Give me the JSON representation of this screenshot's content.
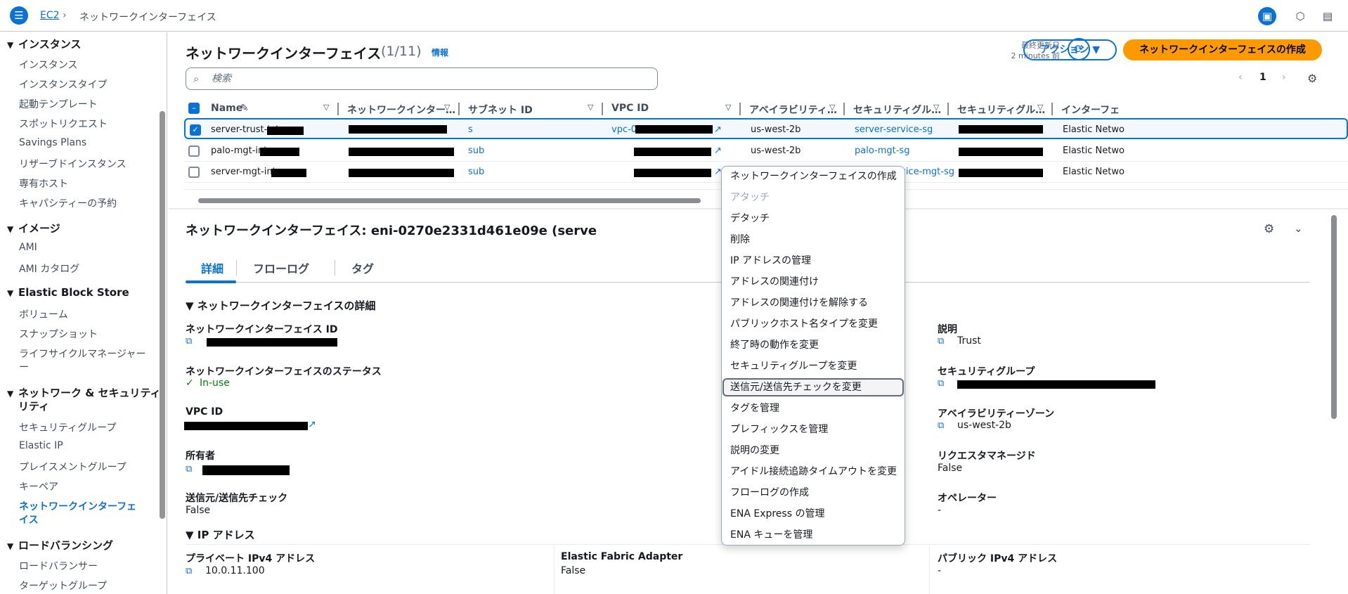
{
  "topbar": {
    "breadcrumb_link": "EC2",
    "breadcrumb_sep": "›",
    "breadcrumb_current": "ネットワークインターフェイス"
  },
  "sidebar": {
    "sections": [
      {
        "title": "インスタンス",
        "items": [
          "インスタンス",
          "インスタンスタイプ",
          "起動テンプレート",
          "スポットリクエスト",
          "Savings Plans",
          "リザーブドインスタンス",
          "専有ホスト",
          "キャパシティーの予約"
        ]
      },
      {
        "title": "イメージ",
        "items": [
          "AMI",
          "AMI カタログ"
        ]
      },
      {
        "title": "Elastic Block Store",
        "items": [
          "ボリューム",
          "スナップショット",
          "ライフサイクルマネージャー"
        ]
      },
      {
        "title": "ネットワーク & セキュリティ",
        "items": [
          "セキュリティグループ",
          "Elastic IP",
          "プレイスメントグループ",
          "キーペア",
          "ネットワークインターフェイス"
        ]
      },
      {
        "title": "ロードバランシング",
        "items": [
          "ロードバランサー",
          "ターゲットグループ"
        ]
      }
    ],
    "sec2_line2": "リティ",
    "item_lifecycle_line2": "ー",
    "item_active_line1": "ネットワークインターフェ",
    "item_active_line2": "イス"
  },
  "header": {
    "title": "ネットワークインターフェイス",
    "count": "(1/11)",
    "info": "情報",
    "last_updated_label": "最終更新日",
    "last_updated_value": "2 minutes 前",
    "actions_label": "アクション ▼",
    "create_label": "ネットワークインターフェイスの作成"
  },
  "search": {
    "placeholder": "検索"
  },
  "pagination": {
    "page": "1"
  },
  "table": {
    "columns": [
      "Name",
      "ネットワークインター…",
      "サブネット ID",
      "VPC ID",
      "アベイラビリティ…",
      "セキュリティグル…",
      "セキュリティグル…",
      "インターフェ"
    ],
    "rows": [
      {
        "name": "server-trust-int-",
        "subnet": "s",
        "vpc": "vpc-0",
        "az": "us-west-2b",
        "sg": "server-service-sg",
        "type": "Elastic Netwo"
      },
      {
        "name": "palo-mgt-int-",
        "subnet": "sub",
        "vpc": "",
        "az": "us-west-2b",
        "sg": "palo-mgt-sg",
        "type": "Elastic Netwo"
      },
      {
        "name": "server-mgt-int-",
        "subnet": "sub",
        "vpc": "",
        "az": "us-west-2b",
        "sg": "server-service-mgt-sg",
        "type": "Elastic Netwo"
      }
    ]
  },
  "detail": {
    "title": "ネットワークインターフェイス: eni-0270e2331d461e09e (serve",
    "tabs": [
      "詳細",
      "フローログ",
      "タグ"
    ],
    "section_title": "ネットワークインターフェイスの詳細",
    "labels": {
      "eni_id": "ネットワークインターフェイス ID",
      "status": "ネットワークインターフェイスのステータス",
      "vpc_id": "VPC ID",
      "owner": "所有者",
      "src_dst": "送信元/送信先チェック",
      "description": "説明",
      "security_group": "セキュリティグループ",
      "az": "アベイラビリティーゾーン",
      "requester_managed": "リクエスタマネージド",
      "operator": "オペレーター"
    },
    "values": {
      "status": "In-use",
      "src_dst": "False",
      "description": "Trust",
      "az": "us-west-2b",
      "requester_managed": "False",
      "operator": "-"
    },
    "ip_section_title": "IP アドレス",
    "ip_labels": {
      "private_ipv4": "プライベート IPv4 アドレス",
      "efa": "Elastic Fabric Adapter",
      "public_ipv4": "パブリック IPv4 アドレス"
    },
    "ip_values": {
      "private_ipv4": "10.0.11.100",
      "efa": "False",
      "public_ipv4": "-"
    }
  },
  "context_menu": {
    "items": [
      "ネットワークインターフェイスの作成",
      "アタッチ",
      "デタッチ",
      "削除",
      "IP アドレスの管理",
      "アドレスの関連付け",
      "アドレスの関連付けを解除する",
      "パブリックホスト名タイプを変更",
      "終了時の動作を変更",
      "セキュリティグループを変更",
      "送信元/送信先チェックを変更",
      "タグを管理",
      "プレフィックスを管理",
      "説明の変更",
      "アイドル接続追跡タイムアウトを変更",
      "フローログの作成",
      "ENA Express の管理",
      "ENA キューを管理"
    ],
    "disabled_index": 1,
    "hover_index": 10
  },
  "colors": {
    "accent": "#0972d3",
    "primary_button": "#ff9900",
    "status_ok": "#037f0c"
  }
}
